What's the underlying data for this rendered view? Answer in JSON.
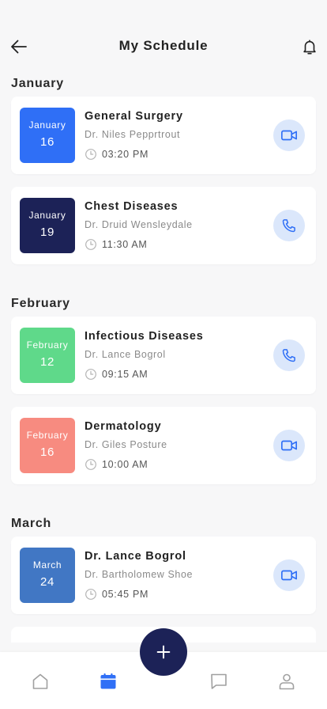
{
  "header": {
    "title": "My Schedule",
    "back_icon": "arrow-left-icon",
    "notification_icon": "bell-icon"
  },
  "months": [
    {
      "name": "January",
      "appointments": [
        {
          "tile_month": "January",
          "day": "16",
          "title": "General Surgery",
          "doctor": "Dr. Niles Pepprtrout",
          "time": "03:20 PM",
          "call_type": "video",
          "tile_color": "#2f6ff6"
        },
        {
          "tile_month": "January",
          "day": "19",
          "title": "Chest Diseases",
          "doctor": "Dr. Druid Wensleydale",
          "time": "11:30 AM",
          "call_type": "phone",
          "tile_color": "#1c2257"
        }
      ]
    },
    {
      "name": "February",
      "appointments": [
        {
          "tile_month": "February",
          "day": "12",
          "title": "Infectious Diseases",
          "doctor": "Dr. Lance Bogrol",
          "time": "09:15 AM",
          "call_type": "phone",
          "tile_color": "#5fd98a"
        },
        {
          "tile_month": "February",
          "day": "16",
          "title": "Dermatology",
          "doctor": "Dr. Giles Posture",
          "time": "10:00 AM",
          "call_type": "video",
          "tile_color": "#f78b80"
        }
      ]
    },
    {
      "name": "March",
      "appointments": [
        {
          "tile_month": "March",
          "day": "24",
          "title": "Dr. Lance Bogrol",
          "doctor": "Dr. Bartholomew Shoe",
          "time": "05:45 PM",
          "call_type": "video",
          "tile_color": "#4177c4"
        }
      ]
    }
  ],
  "colors": {
    "accent": "#2f6ff6",
    "navy": "#1c2257",
    "call_bg": "#dbe7fb",
    "inactive_icon": "#a0a0a0"
  },
  "bottom_nav": {
    "items": [
      {
        "icon": "home-icon",
        "active": false
      },
      {
        "icon": "calendar-icon",
        "active": true
      },
      {
        "icon": "chat-icon",
        "active": false
      },
      {
        "icon": "profile-icon",
        "active": false
      }
    ],
    "fab_icon": "plus-icon"
  }
}
